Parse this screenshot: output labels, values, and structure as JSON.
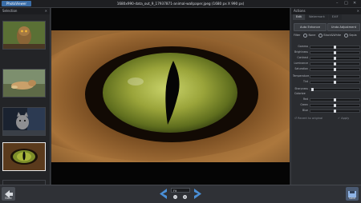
{
  "titlebar": {
    "app_tab": "PhotoViewer",
    "title": "1680x990-data_out_9_17937871-animal-wallpaper.jpeg (1680 px X 990 px)",
    "minimize": "–",
    "maximize": "□",
    "close": "✕"
  },
  "left_panel": {
    "title": "Selection",
    "close": "✕"
  },
  "right_panel": {
    "title": "Actions",
    "close": "✕",
    "tabs": [
      "Edit",
      "Watermark",
      "EXIF"
    ],
    "auto_enhance": "Auto Enhance",
    "undo_adjustment": "Undo Adjustment",
    "filter_label": "Filter",
    "filter_options": [
      "None",
      "Black&White",
      "Sepia"
    ],
    "sliders": {
      "gamma": "Gamma",
      "brightness": "Brightness",
      "contrast": "Contrast",
      "luminance": "Luminance",
      "saturation": "Saturation",
      "temperature": "Temperature",
      "tint": "Tint",
      "sharpness": "Sharpness",
      "colorize": "Colorize",
      "red": "Red",
      "green": "Green",
      "blue": "Blue"
    },
    "reset_to_original": "Revert to original",
    "apply": "Apply"
  },
  "bottom": {
    "back": "Back",
    "zoom": "Fit",
    "save": "Save"
  },
  "colors": {
    "accent": "#3b6ea8",
    "nav_arrow": "#4a8fd6"
  }
}
